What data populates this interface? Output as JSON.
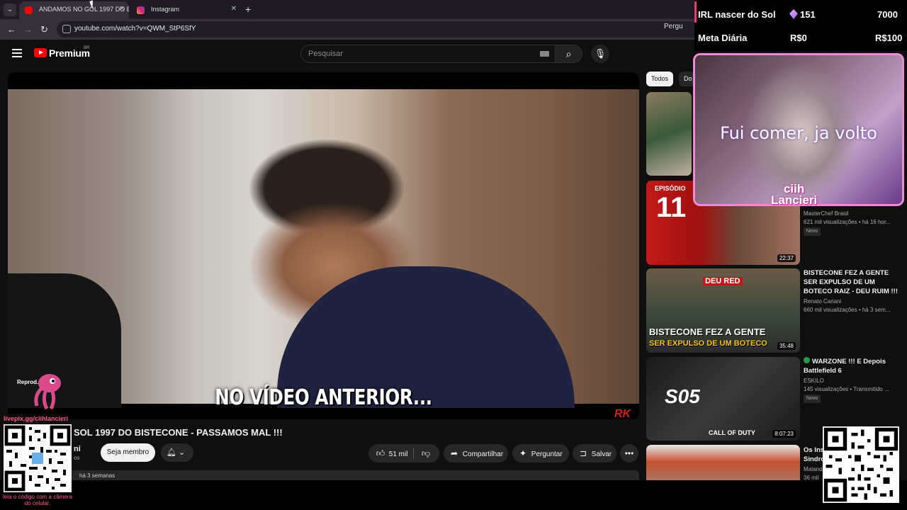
{
  "browser": {
    "tabs": [
      {
        "label": "ANDAMOS NO GOL 1997 DO B",
        "favicon": "youtube-icon",
        "active": true
      },
      {
        "label": "Instagram",
        "favicon": "instagram-icon",
        "active": false
      }
    ],
    "url": "youtube.com/watch?v=QWM_StP6SfY",
    "omni_right": "Pergu"
  },
  "youtube": {
    "brand": "Premium",
    "country": "BR",
    "search_placeholder": "Pesquisar",
    "video": {
      "subtitle": "NO VÍDEO ANTERIOR...",
      "watermark": "RK",
      "title": "SOL 1997 DO BISTECONE - PASSAMOS MAL !!!",
      "channel_fragment": "ni",
      "channel_sub": "os",
      "join_label": "Seja membro",
      "likes": "51 mil",
      "share_label": "Compartilhar",
      "ask_label": "Perguntar",
      "save_label": "Salvar",
      "desc_fragment": "há 3 semanas"
    },
    "chips": {
      "active": "Todos",
      "other": "Do"
    },
    "recommendations": [
      {
        "title": "",
        "channel": "MasterChef Brasil",
        "meta": "621 mil visualizações • há 16 hor...",
        "badge": "Novo",
        "duration": "22:37",
        "thumb_text": "EPISÓDIO",
        "thumb_num": "11"
      },
      {
        "title": "BISTECONE FEZ A GENTE SER EXPULSO DE UM BOTECO RAIZ - DEU RUIM !!!",
        "channel": "Renato Cariani",
        "meta": "660 mil visualizações • há 3 sem...",
        "badge": "",
        "duration": "35:48",
        "thumb_text": "BISTECONE FEZ A GENTE",
        "thumb_sub": "SER EXPULSO DE UM BOTECO",
        "thumb_tag": "DEU RED"
      },
      {
        "title": "WARZONE !!! E Depois Battlefield 6",
        "channel": "ESKILO",
        "meta": "145 visualizações • Transmitido ...",
        "badge": "Novo",
        "duration": "8:07:23",
        "thumb_text": "S05",
        "thumb_sub": "CALL OF DUTY"
      },
      {
        "title": "Os Ins Sindro",
        "channel": "Matando",
        "meta": "36 mil",
        "badge": "",
        "duration": ""
      }
    ]
  },
  "overlay": {
    "goal1_label": "IRL nascer do Sol",
    "goal1_count": "151",
    "goal1_target": "7000",
    "goal2_label": "Meta Diária",
    "goal2_current": "R$0",
    "goal2_target": "R$100",
    "webcam_text": "Fui comer, ja volto",
    "streamer_name_1": "ciih",
    "streamer_name_2": "Lancieri",
    "reprod": "Reprod.",
    "qr_link": "livepix.gg/ciihlancieri",
    "qr_caption": "leia o código com a câmera do celular."
  }
}
